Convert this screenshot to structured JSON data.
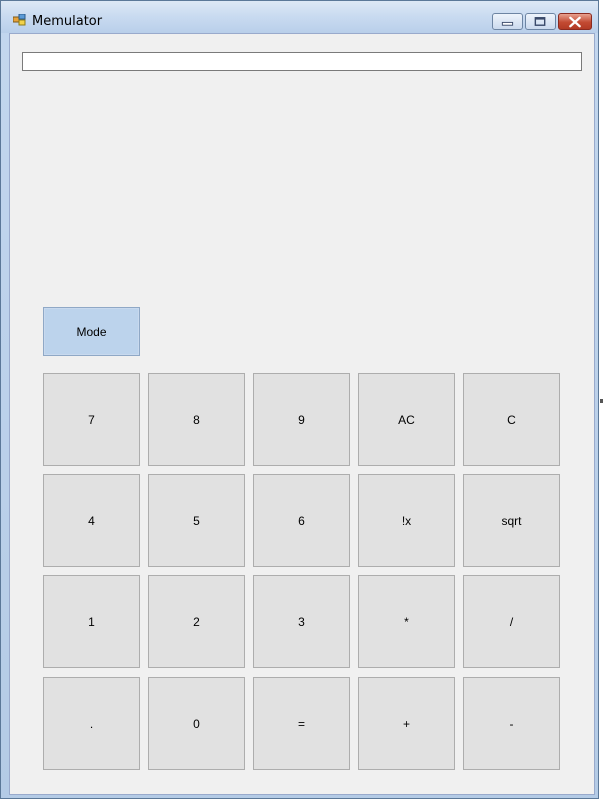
{
  "window": {
    "title": "Memulator"
  },
  "display": {
    "value": ""
  },
  "mode_button": {
    "label": "Mode"
  },
  "keypad": {
    "rows": [
      [
        "7",
        "8",
        "9",
        "AC",
        "C"
      ],
      [
        "4",
        "5",
        "6",
        "!x",
        "sqrt"
      ],
      [
        "1",
        "2",
        "3",
        "*",
        "/"
      ],
      [
        ".",
        "0",
        "=",
        "+",
        "-"
      ]
    ]
  },
  "colors": {
    "client_background": "#f0f0f0",
    "button_face": "#e1e1e1",
    "mode_button_face": "#bcd3ec",
    "close_button": "#c34a33"
  },
  "icons": {
    "app": "application-icon",
    "minimize": "minimize-icon",
    "maximize": "maximize-icon",
    "close": "close-icon"
  }
}
